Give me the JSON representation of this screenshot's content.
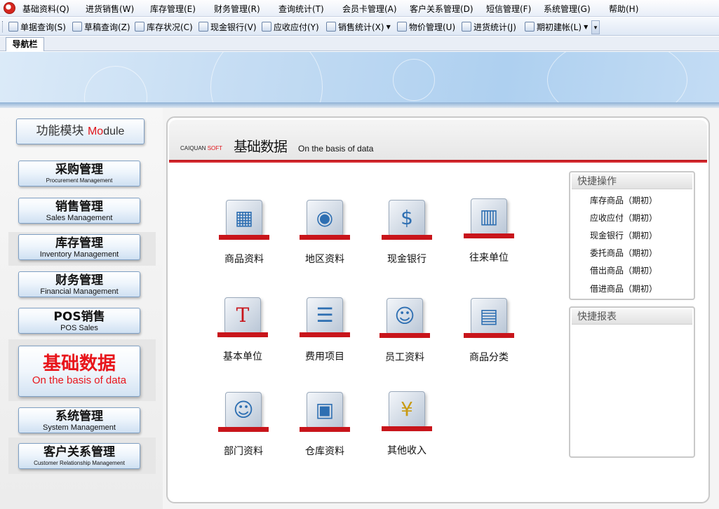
{
  "menubar": {
    "items": [
      "基础资料(Q)",
      "进货销售(W)",
      "库存管理(E)",
      "财务管理(R)",
      "查询统计(T)",
      "会员卡管理(A)",
      "客户关系管理(D)",
      "短信管理(F)",
      "系统管理(G)",
      "帮助(H)"
    ]
  },
  "toolbar": {
    "items": [
      {
        "label": "单据查询(S)",
        "icon": "document-search-icon"
      },
      {
        "label": "草稿查询(Z)",
        "icon": "draft-icon"
      },
      {
        "label": "库存状况(C)",
        "icon": "inventory-icon"
      },
      {
        "label": "现金银行(V)",
        "icon": "cash-bank-icon"
      },
      {
        "label": "应收应付(Y)",
        "icon": "receivable-icon"
      },
      {
        "label": "销售统计(X)",
        "icon": "sales-stats-icon"
      },
      {
        "label": "物价管理(U)",
        "icon": "price-icon"
      },
      {
        "label": "进货统计(J)",
        "icon": "purchase-stats-icon"
      },
      {
        "label": "期初建帐(L)",
        "icon": "opening-account-icon"
      }
    ]
  },
  "tabs": {
    "nav_label": "导航栏"
  },
  "sidebar": {
    "module_title_zh": "功能模块",
    "module_title_en_red": "Mo",
    "module_title_en_rest": "dule",
    "modules": [
      {
        "zh": "采购管理",
        "en": "Procurement Management"
      },
      {
        "zh": "销售管理",
        "en": "Sales Management"
      },
      {
        "zh": "库存管理",
        "en": "Inventory Management"
      },
      {
        "zh": "财务管理",
        "en": "Financial Management"
      },
      {
        "zh": "POS销售",
        "en": "POS Sales"
      },
      {
        "zh": "基础数据",
        "en": "On the basis of data"
      },
      {
        "zh": "系统管理",
        "en": "System Management"
      },
      {
        "zh": "客户关系管理",
        "en": "Customer Relationship Management"
      }
    ]
  },
  "header": {
    "brand_caiquan": "CAIQUAN",
    "brand_soft": "SOFT",
    "title": "基础数据",
    "subtitle": "On the basis of data"
  },
  "tiles": [
    {
      "label": "商品资料",
      "icon": "product-cube-icon"
    },
    {
      "label": "地区资料",
      "icon": "globe-region-icon"
    },
    {
      "label": "现金银行",
      "icon": "bank-building-icon"
    },
    {
      "label": "往来单位",
      "icon": "city-buildings-icon"
    },
    {
      "label": "基本单位",
      "icon": "letter-t-unit-icon"
    },
    {
      "label": "费用项目",
      "icon": "expense-documents-icon"
    },
    {
      "label": "员工资料",
      "icon": "employee-icon"
    },
    {
      "label": "商品分类",
      "icon": "category-blocks-icon"
    },
    {
      "label": "部门资料",
      "icon": "department-icon"
    },
    {
      "label": "仓库资料",
      "icon": "warehouse-icon"
    },
    {
      "label": "其他收入",
      "icon": "other-income-icon"
    }
  ],
  "quick_ops": {
    "title": "快捷操作",
    "items": [
      "库存商品（期初）",
      "应收应付（期初）",
      "现金银行（期初）",
      "委托商品（期初）",
      "借出商品（期初）",
      "借进商品（期初）"
    ]
  },
  "quick_reports": {
    "title": "快捷报表"
  },
  "colors": {
    "accent_red": "#e0141a",
    "header_line": "#c8151b",
    "banner_blue": "#aed0f0"
  }
}
